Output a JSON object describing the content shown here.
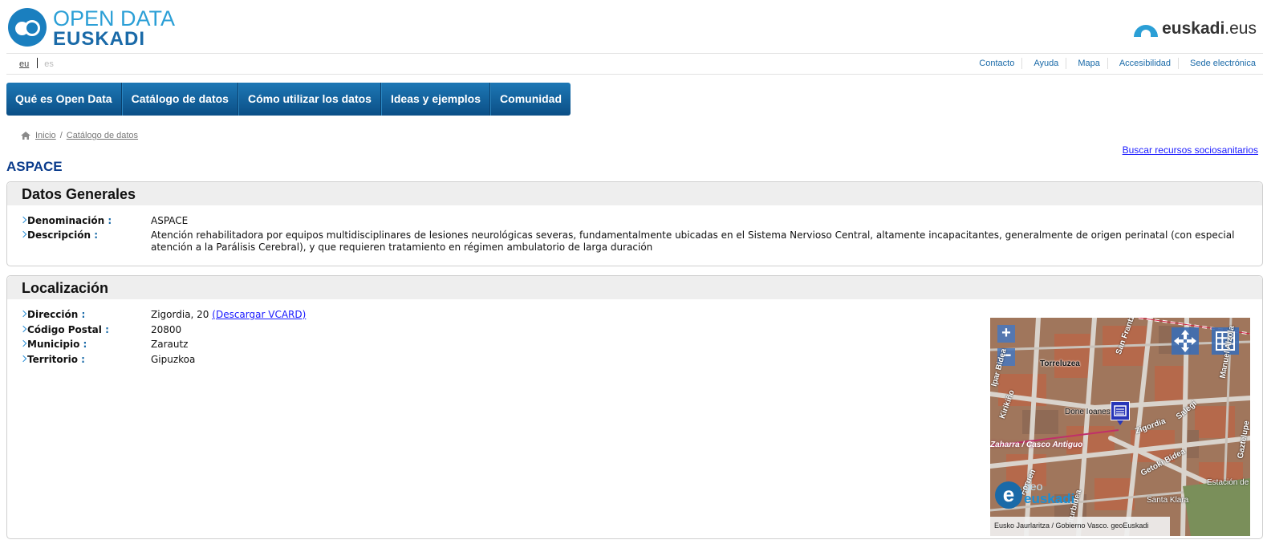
{
  "header": {
    "logo_line1": "OPEN DATA",
    "logo_line2": "EUSKADI",
    "euskadi_brand": "euskadi",
    "euskadi_tld": ".eus"
  },
  "languages": {
    "active": "eu",
    "inactive": "es"
  },
  "top_links": [
    "Contacto",
    "Ayuda",
    "Mapa",
    "Accesibilidad",
    "Sede electrónica"
  ],
  "nav": [
    "Qué es Open Data",
    "Catálogo de datos",
    "Cómo utilizar los datos",
    "Ideas y ejemplos",
    "Comunidad"
  ],
  "breadcrumb": {
    "home": "Inicio",
    "separator": "/",
    "current": "Catálogo de datos"
  },
  "search_link": "Buscar recursos sociosanitarios",
  "title": "ASPACE",
  "general": {
    "heading": "Datos Generales",
    "denominacion_label": "Denominación",
    "denominacion_value": "ASPACE",
    "descripcion_label": "Descripción",
    "descripcion_value": "Atención rehabilitadora por equipos multidisciplinares de lesiones neurológicas severas, fundamentalmente ubicadas en el Sistema Nervioso Central, altamente incapacitantes, generalmente de origen perinatal (con especial atención a la Parálisis Cerebral), y que requieren tratamiento en régimen ambulatorio de larga duración"
  },
  "location": {
    "heading": "Localización",
    "direccion_label": "Dirección",
    "direccion_value": "Zigordia, 20",
    "vcard_link": "(Descargar VCARD)",
    "cp_label": "Código Postal",
    "cp_value": "20800",
    "municipio_label": "Municipio",
    "municipio_value": "Zarautz",
    "territorio_label": "Territorio",
    "territorio_value": "Gipuzkoa",
    "colon": ":"
  },
  "map": {
    "zoom_in": "+",
    "zoom_out": "−",
    "labels": [
      "Torreluzea",
      "Done Ioanes",
      "Zigordia",
      "Zaharra / Casco Antiguo",
      "Getoki Bidea",
      "Estación de",
      "Santa Klara",
      "San Frantzisko",
      "Salegi",
      "Manuel Alzola",
      "Iturbidea",
      "Foruen",
      "Kirikiño",
      "Ipar Bidea",
      "Gaztelupe"
    ],
    "geo_e": "e",
    "geo_small": "geo",
    "geo_big": "euskadi",
    "attribution": "Eusko Jaurlaritza / Gobierno Vasco. geoEuskadi",
    "colors": {
      "roof": "#b06a4c",
      "street": "#d8d2cb",
      "button": "#4678be"
    }
  }
}
